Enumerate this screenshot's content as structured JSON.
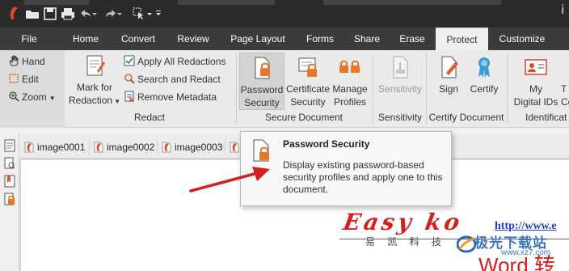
{
  "titlebar": {
    "right_text": "i"
  },
  "menubar": {
    "items": [
      {
        "label": "File"
      },
      {
        "label": "Home"
      },
      {
        "label": "Convert"
      },
      {
        "label": "Review"
      },
      {
        "label": "Page Layout"
      },
      {
        "label": "Forms"
      },
      {
        "label": "Share"
      },
      {
        "label": "Erase"
      },
      {
        "label": "Protect"
      },
      {
        "label": "Customize"
      }
    ],
    "active": "Protect"
  },
  "ribbon": {
    "tools": {
      "hand": "Hand",
      "edit": "Edit",
      "zoom": "Zoom"
    },
    "redact": {
      "mark_for_redaction_line1": "Mark for",
      "mark_for_redaction_line2": "Redaction",
      "apply_all": "Apply All Redactions",
      "search_and_redact": "Search and Redact",
      "remove_metadata": "Remove Metadata",
      "group_label": "Redact"
    },
    "secure": {
      "password_line1": "Password",
      "password_line2": "Security",
      "certificate_line1": "Certificate",
      "certificate_line2": "Security",
      "manage_line1": "Manage",
      "manage_line2": "Profiles",
      "group_label": "Secure Document"
    },
    "sensitivity": {
      "button": "Sensitivity",
      "group_label": "Sensitivity"
    },
    "certify": {
      "sign": "Sign",
      "certify": "Certify",
      "group_label": "Certify Document"
    },
    "identification": {
      "my_line1": "My",
      "my_line2": "Digital IDs",
      "partial_line1": "T",
      "partial_line2": "Co",
      "group_label": "Identificat"
    }
  },
  "tabs": [
    {
      "label": "image0001"
    },
    {
      "label": "image0002"
    },
    {
      "label": "image0003"
    }
  ],
  "tooltip": {
    "title": "Password Security",
    "description": "Display existing password-based security profiles and apply one to this document."
  },
  "document": {
    "logo_text": "Easy ko",
    "logo_sub": "易 凯 科 技",
    "url": "http://www.e",
    "word": "Word 转"
  },
  "watermark": {
    "text": "极光下载站",
    "url": "www.xz7.com"
  },
  "colors": {
    "menubar_bg": "#3b3b3b",
    "titlebar_bg": "#2b2b2b",
    "accent_red": "#d62020",
    "lock_orange": "#e8772e"
  }
}
